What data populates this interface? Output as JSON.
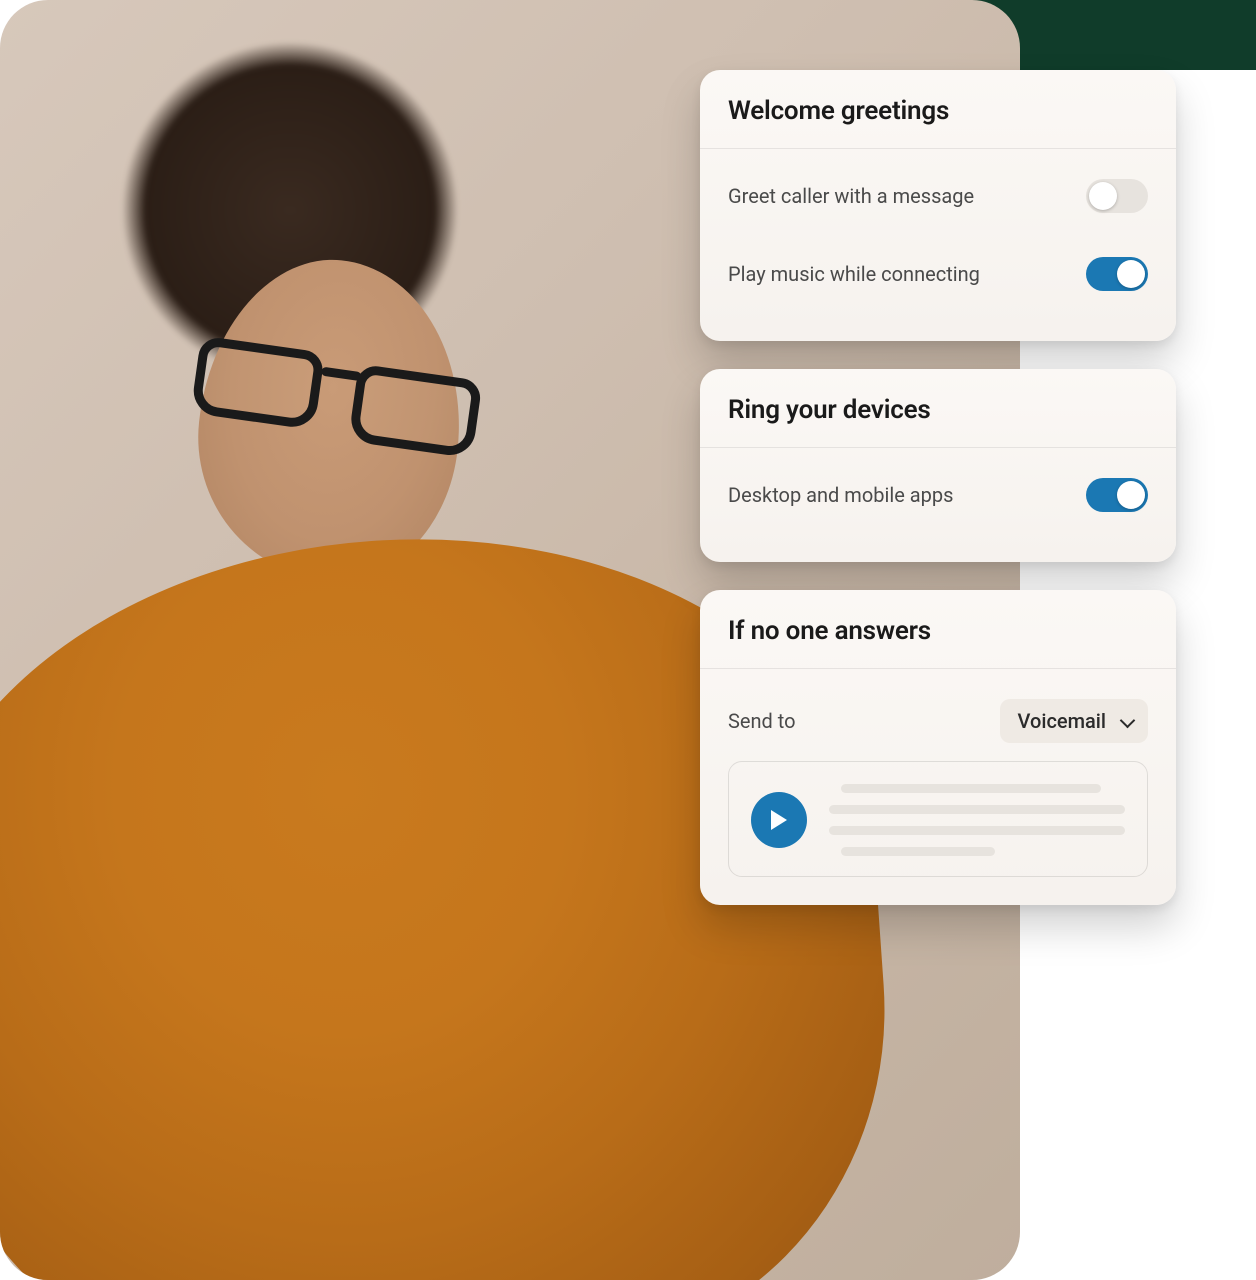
{
  "cards": {
    "greetings": {
      "title": "Welcome greetings",
      "items": [
        {
          "label": "Greet caller with a message",
          "on": false
        },
        {
          "label": "Play music while connecting",
          "on": true
        }
      ]
    },
    "devices": {
      "title": "Ring your devices",
      "items": [
        {
          "label": "Desktop and mobile apps",
          "on": true
        }
      ]
    },
    "no_answer": {
      "title": "If no one answers",
      "send_to_label": "Send to",
      "send_to_value": "Voicemail"
    }
  },
  "colors": {
    "accent": "#1b78b3",
    "toggle_off": "#e7e3de"
  }
}
